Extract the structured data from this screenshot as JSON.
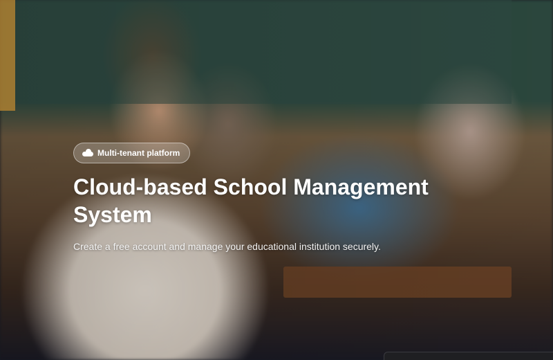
{
  "hero": {
    "badge": {
      "icon": "cloud-icon",
      "label": "Multi-tenant platform"
    },
    "title": "Cloud-based School Management System",
    "subtitle": "Create a free account and manage your educational institution securely."
  }
}
